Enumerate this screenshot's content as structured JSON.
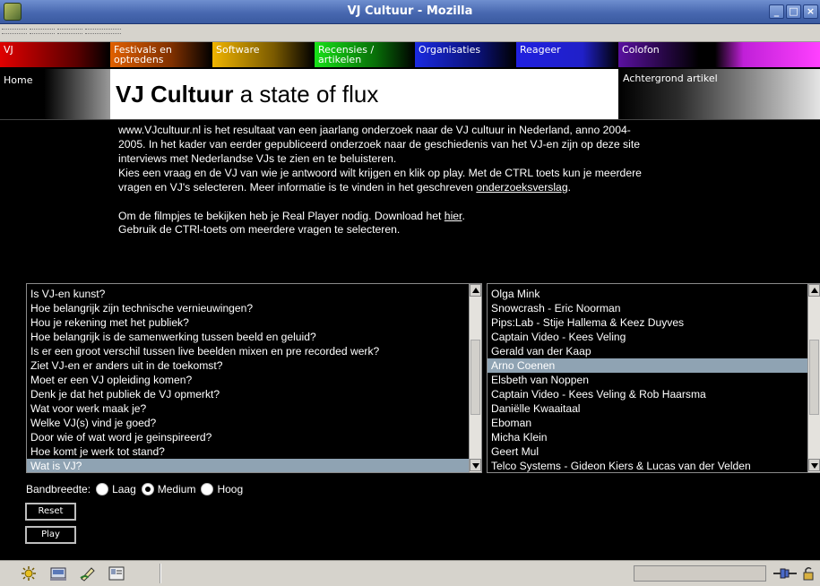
{
  "window": {
    "title": "VJ Cultuur - Mozilla",
    "buttons": [
      "_",
      "□",
      "×"
    ]
  },
  "nav": [
    {
      "label": "VJ",
      "color": "#c80000"
    },
    {
      "label": "Festivals en optredens",
      "color": "#c84a00"
    },
    {
      "label": "Software",
      "color": "#c89c00"
    },
    {
      "label": "Recensies / artikelen",
      "color": "#10c010"
    },
    {
      "label": "Organisaties",
      "color": "#1018c8"
    },
    {
      "label": "Reageer",
      "color": "#1010b8"
    },
    {
      "label": "Colofon",
      "color": "#9a10c8"
    }
  ],
  "header": {
    "home": "Home",
    "title_bold": "VJ Cultuur",
    "title_rest": "a state of flux",
    "achtergrond": "Achtergrond artikel"
  },
  "intro": {
    "p1": "www.VJcultuur.nl is het resultaat van een jaarlang onderzoek naar de VJ cultuur in Nederland, anno 2004-2005. In het kader van eerder gepubliceerd onderzoek naar de geschiedenis van het VJ-en zijn op deze site interviews met Nederlandse VJs te zien en te beluisteren.",
    "p2": "Kies een vraag en de VJ van wie je antwoord wilt krijgen en klik op play. Met de CTRL toets kun je meerdere vragen en VJ's selecteren. Meer informatie is te vinden in het geschreven",
    "p2_link": "onderzoeksverslag",
    "p2_end": ".",
    "p3": "Om de filmpjes te bekijken heb je Real Player nodig. Download het",
    "p3_link": "hier",
    "p3_end": ".",
    "p4": "Gebruik de CTRl-toets om meerdere vragen te selecteren."
  },
  "questions": [
    "Is VJ-en kunst?",
    "Hoe belangrijk zijn technische vernieuwingen?",
    "Hou je rekening met het publiek?",
    "Hoe belangrijk is de samenwerking tussen beeld en geluid?",
    "Is er een groot verschil tussen live beelden mixen en pre recorded werk?",
    "Ziet VJ-en er anders uit in de toekomst?",
    "Moet er een VJ opleiding komen?",
    "Denk je dat het publiek de VJ opmerkt?",
    "Wat voor werk maak je?",
    "Welke VJ(s) vind je goed?",
    "Door wie of wat word je geinspireerd?",
    "Hoe komt je werk tot stand?",
    "Wat is VJ?"
  ],
  "questions_selected": 12,
  "vjs": [
    "Olga Mink",
    "Snowcrash - Eric Noorman",
    "Pips:Lab - Stije Hallema & Keez Duyves",
    "Captain Video - Kees Veling",
    "Gerald van der Kaap",
    "Arno Coenen",
    "Elsbeth van Noppen",
    "Captain Video - Kees Veling & Rob Haarsma",
    "Daniëlle Kwaaitaal",
    "Eboman",
    "Micha Klein",
    "Geert Mul",
    "Telco Systems - Gideon Kiers & Lucas van der Velden"
  ],
  "vjs_selected": 5,
  "bandwidth": {
    "label": "Bandbreedte:",
    "options": [
      "Laag",
      "Medium",
      "Hoog"
    ],
    "selected": "Medium"
  },
  "buttons": {
    "reset": "Reset",
    "play": "Play"
  },
  "statusbar": {
    "icons": [
      "navigator-icon",
      "mail-icon",
      "composer-icon",
      "address-book-icon"
    ]
  }
}
